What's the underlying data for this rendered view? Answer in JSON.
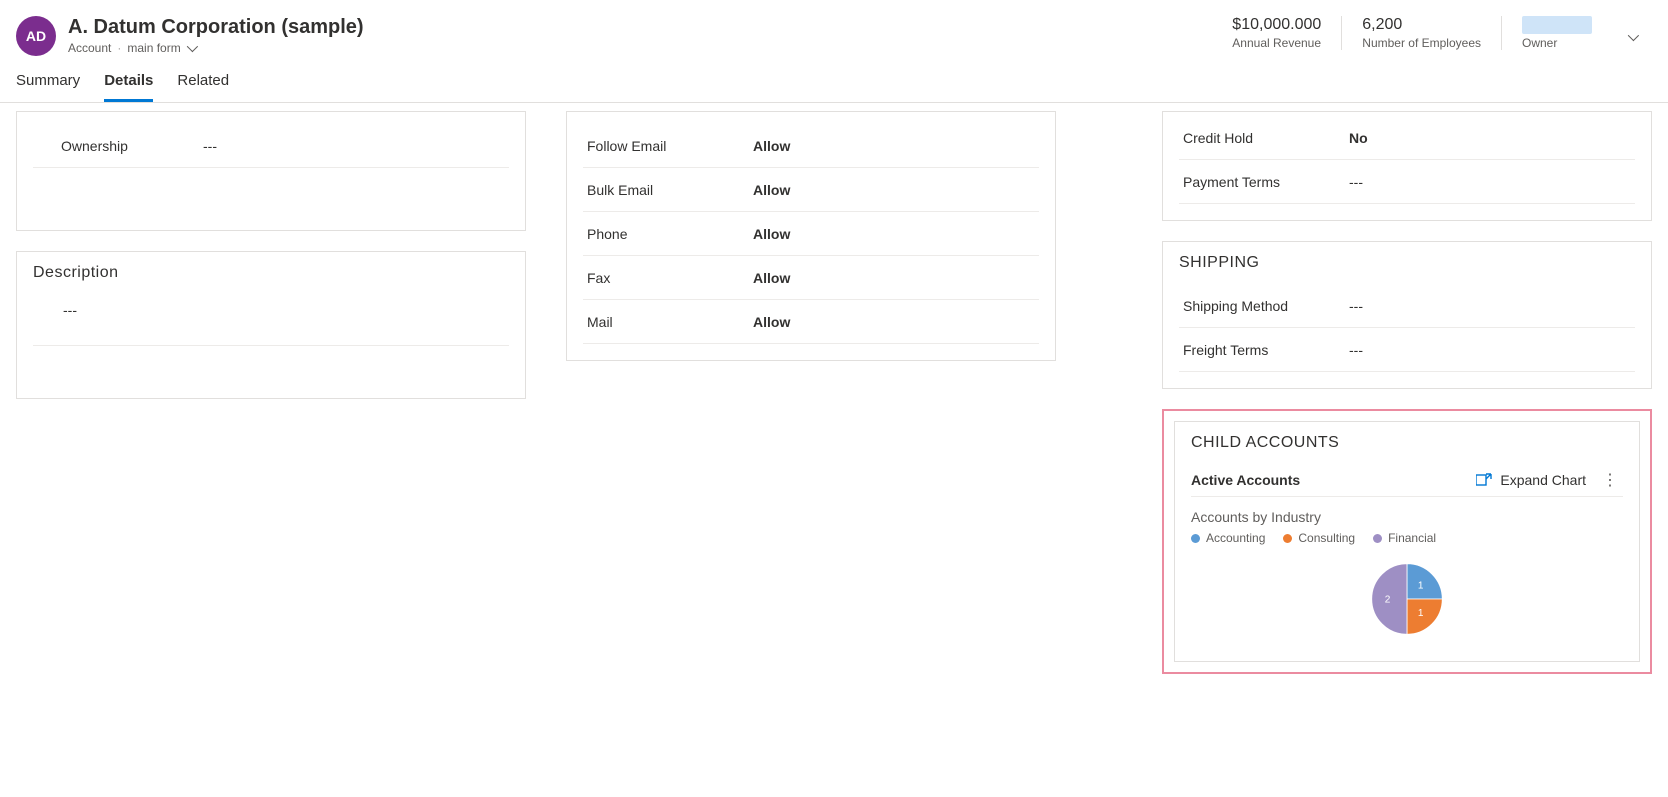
{
  "header": {
    "avatar_text": "AD",
    "title": "A. Datum Corporation (sample)",
    "entity_label": "Account",
    "form_label": "main form",
    "metrics": {
      "revenue_value": "$10,000.000",
      "revenue_label": "Annual Revenue",
      "employees_value": "6,200",
      "employees_label": "Number of Employees",
      "owner_label": "Owner"
    }
  },
  "tabs": {
    "summary": "Summary",
    "details": "Details",
    "related": "Related"
  },
  "company": {
    "ownership_label": "Ownership",
    "ownership_value": "---"
  },
  "description": {
    "title": "Description",
    "value": "---"
  },
  "contact_prefs": {
    "follow_email_label": "Follow Email",
    "follow_email_value": "Allow",
    "bulk_email_label": "Bulk Email",
    "bulk_email_value": "Allow",
    "phone_label": "Phone",
    "phone_value": "Allow",
    "fax_label": "Fax",
    "fax_value": "Allow",
    "mail_label": "Mail",
    "mail_value": "Allow"
  },
  "billing": {
    "credit_hold_label": "Credit Hold",
    "credit_hold_value": "No",
    "payment_terms_label": "Payment Terms",
    "payment_terms_value": "---"
  },
  "shipping": {
    "title": "SHIPPING",
    "method_label": "Shipping Method",
    "method_value": "---",
    "freight_label": "Freight Terms",
    "freight_value": "---"
  },
  "child_accounts": {
    "title": "CHILD ACCOUNTS",
    "subtitle": "Active Accounts",
    "expand_label": "Expand Chart",
    "chart_title": "Accounts by Industry",
    "legend": {
      "accounting": "Accounting",
      "consulting": "Consulting",
      "financial": "Financial"
    }
  },
  "colors": {
    "accounting": "#5b9bd5",
    "consulting": "#ed7d31",
    "financial": "#9e8fc4"
  },
  "chart_data": {
    "type": "pie",
    "title": "Accounts by Industry",
    "series": [
      {
        "name": "Accounting",
        "value": 1,
        "color": "#5b9bd5"
      },
      {
        "name": "Consulting",
        "value": 1,
        "color": "#ed7d31"
      },
      {
        "name": "Financial",
        "value": 2,
        "color": "#9e8fc4"
      }
    ]
  }
}
